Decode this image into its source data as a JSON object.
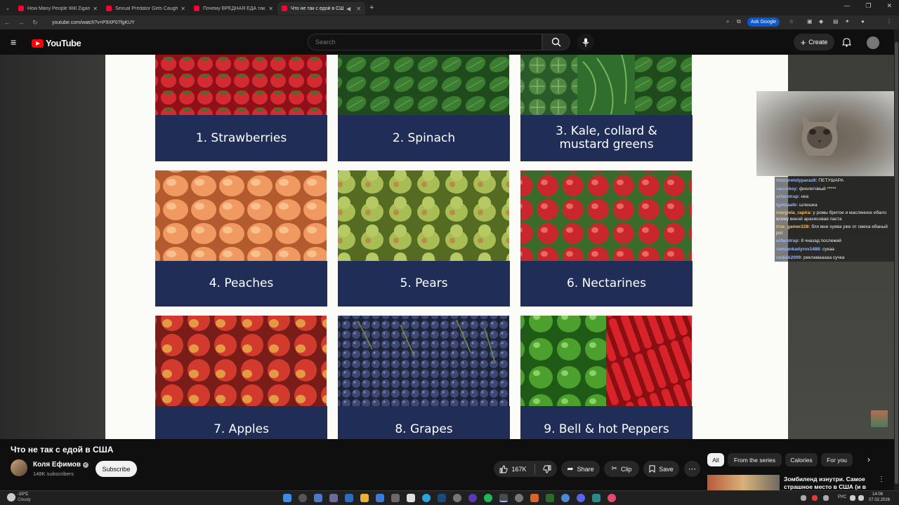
{
  "browser": {
    "tabs": [
      {
        "title": "How Many People Will Zigant"
      },
      {
        "title": "Sexual Predator Gets Caught in"
      },
      {
        "title": "Почему ВРЕДНАЯ ЕДА такая"
      },
      {
        "title": "Что не так с едой в США"
      }
    ],
    "url": "youtube.com/watch?v=P9XP07fgKUY",
    "ask_google": "Ask Google"
  },
  "youtube": {
    "logo_text": "YouTube",
    "search_placeholder": "Search",
    "create_label": "Create"
  },
  "video": {
    "slide_items": [
      {
        "label": "1. Strawberries"
      },
      {
        "label": "2. Spinach"
      },
      {
        "label": "3. Kale, collard & mustard greens"
      },
      {
        "label": "4. Peaches"
      },
      {
        "label": "5. Pears"
      },
      {
        "label": "6. Nectarines"
      },
      {
        "label": "7. Apples"
      },
      {
        "label": "8. Grapes"
      },
      {
        "label": "9. Bell & hot Peppers"
      }
    ],
    "colors": {
      "label_band": "#1f2d57",
      "strawberries": "#c8202b",
      "spinach": "#2f6a2a",
      "kale": "#3d6b35",
      "peaches": "#e88650",
      "pears": "#9bb04a",
      "nectarines": "#b82a2e",
      "apples": "#c43a2e",
      "grapes": "#3a4466",
      "peppers": "#3f8c2a"
    }
  },
  "chat": [
    {
      "user": "interpretolyparaz8:",
      "msg": "ПЕТУШАРА"
    },
    {
      "user": "raccoboy:",
      "msg": "фиолетовый *****"
    },
    {
      "user": "ezfarotrap:",
      "msg": "неа"
    },
    {
      "user": "tgotsaalb:",
      "msg": "шлюшка"
    },
    {
      "user": "margiela_rapira:",
      "msg": "у ромы бритое и маслянное ебало всему виной арахисовая паста"
    },
    {
      "user": "true_gamer228:",
      "msg": "бля мне хуева уже от смеха ебаный рот"
    },
    {
      "user": "ezfarotrap:",
      "msg": "8 чназад послежий"
    },
    {
      "user": "ramzankadyrov1488:",
      "msg": "сукаа"
    },
    {
      "user": "vodaik2009:",
      "msg": "рекламааааа сучка"
    }
  ],
  "below": {
    "title": "Что не так с едой в США",
    "channel": "Коля Ефимов",
    "subscribers": "148K subscribers",
    "subscribe_label": "Subscribe",
    "likes": "167K",
    "share_label": "Share",
    "clip_label": "Clip",
    "save_label": "Save",
    "chips": [
      "All",
      "From the series",
      "Calories",
      "For you"
    ],
    "related_title": "Зомбиленд изнутри. Самое страшное место в США (и в"
  },
  "taskbar": {
    "temp": "-10°C",
    "weather": "Cloudy",
    "lang": "РУС",
    "time": "14:08",
    "date": "07.02.2026"
  }
}
